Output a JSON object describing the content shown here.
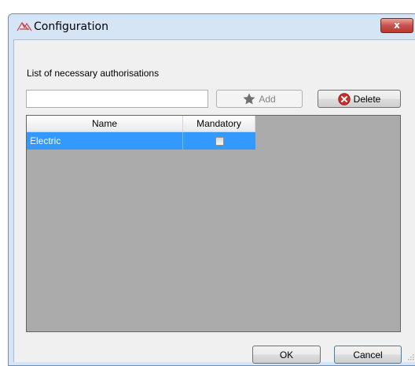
{
  "window": {
    "title": "Configuration",
    "close_glyph": "x",
    "app_icon": "configuration-app-icon"
  },
  "form": {
    "caption": "List of necessary authorisations",
    "input_value": "",
    "input_placeholder": ""
  },
  "toolbar": {
    "add_label": "Add",
    "add_icon": "star-icon",
    "add_enabled": false,
    "delete_label": "Delete",
    "delete_icon": "delete-x-icon"
  },
  "grid": {
    "columns": [
      "Name",
      "Mandatory"
    ],
    "rows": [
      {
        "name": "Electric",
        "mandatory": false,
        "selected": true
      }
    ]
  },
  "footer": {
    "ok_label": "OK",
    "cancel_label": "Cancel"
  },
  "colors": {
    "selection": "#3399ff",
    "grid_background": "#ababab",
    "close_button": "#c75050"
  }
}
